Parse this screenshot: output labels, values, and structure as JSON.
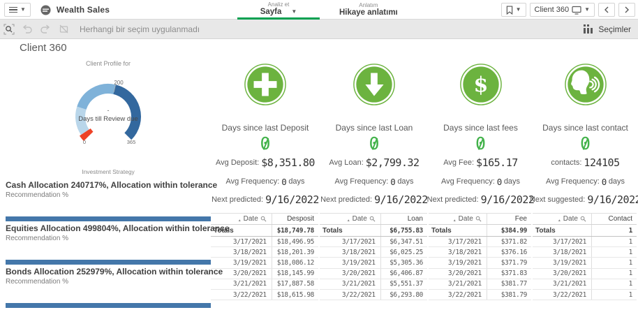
{
  "colors": {
    "accent_green": "#6cb33f",
    "value_green": "#42b24a",
    "bar_blue": "#4477aa",
    "tab_underline": "#00a050",
    "gauge_red": "#ee4226",
    "gauge_light": "#b9d6ea",
    "gauge_mid": "#7fb2d9",
    "gauge_dark": "#33689e"
  },
  "topbar": {
    "app_name": "Wealth Sales",
    "tabs": [
      {
        "small": "Analiz et",
        "label": "Sayfa"
      },
      {
        "small": "Anlatım",
        "label": "Hikaye anlatımı"
      }
    ],
    "sheet_name": "Client 360"
  },
  "toolbar": {
    "selection_status": "Herhangi bir seçim uygulanmadı",
    "selections_label": "Seçimler"
  },
  "page_title": "Client 360",
  "gauge": {
    "title": "Client Profile for",
    "min": "0",
    "max": "365",
    "tick": "200",
    "center_dash": "-",
    "center_label": "Days till Review due",
    "segments": [
      {
        "from": 0,
        "to": 15,
        "color": "red"
      },
      {
        "from": 15,
        "to": 85,
        "color": "light-blue"
      },
      {
        "from": 85,
        "to": 200,
        "color": "mid-blue"
      },
      {
        "from": 200,
        "to": 365,
        "color": "dark-blue"
      }
    ]
  },
  "investment_strategy_label": "Investment Strategy",
  "allocations": [
    {
      "title": "Cash Allocation 240717%, Allocation within tolerance",
      "subtitle": "Recommendation %"
    },
    {
      "title": "Equities Allocation 499804%, Allocation within tolerance",
      "subtitle": "Recommendation %"
    },
    {
      "title": "Bonds Allocation 252979%, Allocation within tolerance",
      "subtitle": "Recommendation %"
    }
  ],
  "kpis": [
    {
      "icon": "plus",
      "title": "Days since last Deposit",
      "value": "0",
      "avg_label": "Avg Deposit:",
      "avg_value": "$8,351.80",
      "freq_label": "Avg Frequency:",
      "freq_value": "0",
      "freq_suffix": "days",
      "next_label": "Next predicted:",
      "next_value": "9/16/2022",
      "table": {
        "date_header": "Date",
        "value_header": "Desposit",
        "totals_label": "Totals",
        "total": "$18,749.78",
        "rows": [
          [
            "3/17/2021",
            "$18,496.95"
          ],
          [
            "3/18/2021",
            "$18,201.39"
          ],
          [
            "3/19/2021",
            "$18,086.12"
          ],
          [
            "3/20/2021",
            "$18,145.99"
          ],
          [
            "3/21/2021",
            "$17,887.58"
          ],
          [
            "3/22/2021",
            "$18,615.98"
          ]
        ]
      }
    },
    {
      "icon": "arrow-down",
      "title": "Days since last Loan",
      "value": "0",
      "avg_label": "Avg Loan:",
      "avg_value": "$2,799.32",
      "freq_label": "Avg Frequency:",
      "freq_value": "0",
      "freq_suffix": "days",
      "next_label": "Next predicted:",
      "next_value": "9/16/2022",
      "table": {
        "date_header": "Date",
        "value_header": "Loan",
        "totals_label": "Totals",
        "total": "$6,755.83",
        "rows": [
          [
            "3/17/2021",
            "$6,347.51"
          ],
          [
            "3/18/2021",
            "$6,025.25"
          ],
          [
            "3/19/2021",
            "$5,305.36"
          ],
          [
            "3/20/2021",
            "$6,406.87"
          ],
          [
            "3/21/2021",
            "$5,551.37"
          ],
          [
            "3/22/2021",
            "$6,293.80"
          ]
        ]
      }
    },
    {
      "icon": "dollar",
      "title": "Days since last fees",
      "value": "0",
      "avg_label": "Avg Fee:",
      "avg_value": "$165.17",
      "freq_label": "Avg Frequency:",
      "freq_value": "0",
      "freq_suffix": "days",
      "next_label": "Next predicted:",
      "next_value": "9/16/2022",
      "table": {
        "date_header": "Date",
        "value_header": "Fee",
        "totals_label": "Totals",
        "total": "$384.99",
        "rows": [
          [
            "3/17/2021",
            "$371.82"
          ],
          [
            "3/18/2021",
            "$376.16"
          ],
          [
            "3/19/2021",
            "$371.79"
          ],
          [
            "3/20/2021",
            "$371.83"
          ],
          [
            "3/21/2021",
            "$381.77"
          ],
          [
            "3/22/2021",
            "$381.79"
          ]
        ]
      }
    },
    {
      "icon": "contact",
      "title": "Days since last contact",
      "value": "0",
      "avg_label": "contacts:",
      "avg_value": "124105",
      "freq_label": "Avg Frequency:",
      "freq_value": "0",
      "freq_suffix": "days",
      "next_label": "Next suggested:",
      "next_value": "9/16/2022",
      "table": {
        "date_header": "Date",
        "value_header": "Contact",
        "totals_label": "Totals",
        "total": "1",
        "rows": [
          [
            "3/17/2021",
            "1"
          ],
          [
            "3/18/2021",
            "1"
          ],
          [
            "3/19/2021",
            "1"
          ],
          [
            "3/20/2021",
            "1"
          ],
          [
            "3/21/2021",
            "1"
          ],
          [
            "3/22/2021",
            "1"
          ]
        ]
      }
    }
  ]
}
